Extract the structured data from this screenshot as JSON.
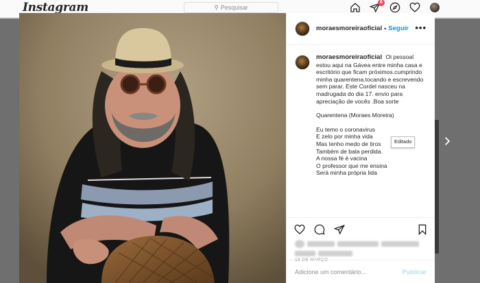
{
  "nav": {
    "logo": "Instagram",
    "search_placeholder": "Pesquisar",
    "notifications_count": "6",
    "icons": [
      "home-icon",
      "direct-icon",
      "explore-icon",
      "heart-icon",
      "avatar"
    ]
  },
  "photo": {
    "alt": "Moraes Moreira"
  },
  "post": {
    "username": "moraesmoreiraoficial",
    "separator": "•",
    "follow_label": "Seguir",
    "more_label": "•••",
    "caption_intro": "Oi pessoal estou aqui na Gávea entre minha casa e escritório que ficam próximos.cumprindo minha quarentena.tocando e escrevendo sem parar. Este Cordel nasceu na madrugada do dia 17. envio para apreciação de vocês .Boa sorte",
    "caption_title": "Quarentena (Moraes Moreira)",
    "poem_lines": [
      "Eu temo o coronavirus",
      "E zelo por minha vida",
      "Mas tenho medo de tiros",
      "Também de bala perdida.",
      "A nossa fé é vacina",
      "O professor que me ensina",
      "Será minha própria lida"
    ],
    "tooltip": "Editado",
    "date": "18 DE MARÇO",
    "comment_placeholder": "Adicione um comentário...",
    "publish_label": "Publicar"
  },
  "colors": {
    "accent": "#0095f6",
    "badge": "#ed4956",
    "publish_disabled": "#b2dffc"
  }
}
